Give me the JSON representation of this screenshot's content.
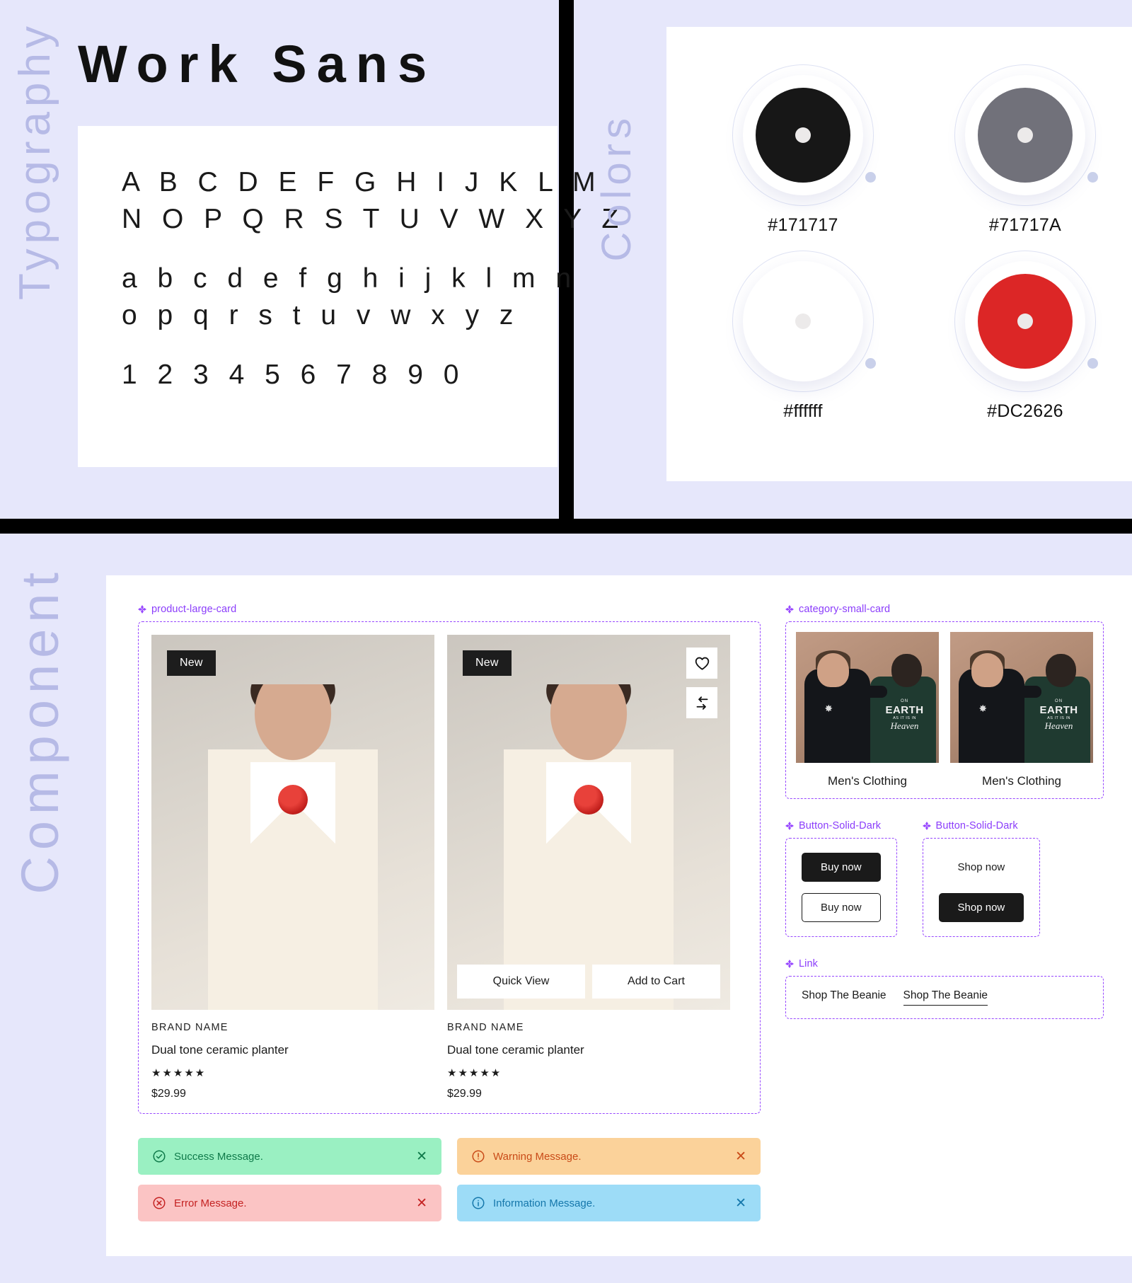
{
  "sections": {
    "typography_label": "Typography",
    "colors_label": "Colors",
    "component_label": "Component"
  },
  "typography": {
    "font_name": "Work Sans",
    "uppercase_line_1": "A B C D E F G H I J K L M",
    "uppercase_line_2": "N O P Q R S T U V W X Y Z",
    "lowercase_line_1": "a b c d e f g h i j k l m n",
    "lowercase_line_2": "o p q r s t u v w x y z",
    "numerals": "1 2 3 4 5 6 7 8 9 0"
  },
  "colors": {
    "swatches": [
      {
        "hex": "#171717",
        "label": "#171717"
      },
      {
        "hex": "#71717A",
        "label": "#71717A"
      },
      {
        "hex": "#ffffff",
        "label": "#ffffff"
      },
      {
        "hex": "#DC2626",
        "label": "#DC2626"
      }
    ],
    "annotation_color": "#9747ff"
  },
  "component": {
    "product_card": {
      "tag": "product-large-card",
      "cards": [
        {
          "badge": "New",
          "brand": "BRAND NAME",
          "name": "Dual tone ceramic planter",
          "rating_stars": "★★★★★",
          "price": "$29.99",
          "has_icons": false,
          "has_overlay_actions": false
        },
        {
          "badge": "New",
          "brand": "BRAND NAME",
          "name": "Dual tone ceramic planter",
          "rating_stars": "★★★★★",
          "price": "$29.99",
          "has_icons": true,
          "wishlist_icon": "heart-icon",
          "compare_icon": "compare-arrows-icon",
          "quick_view_label": "Quick View",
          "add_to_cart_label": "Add to Cart"
        }
      ]
    },
    "category_card": {
      "tag": "category-small-card",
      "items": [
        {
          "label": "Men's Clothing",
          "tee_l1": "ON",
          "tee_l2": "EARTH",
          "tee_l3": "AS IT IS IN",
          "tee_l4": "Heaven"
        },
        {
          "label": "Men's Clothing",
          "tee_l1": "ON",
          "tee_l2": "EARTH",
          "tee_l3": "AS IT IS IN",
          "tee_l4": "Heaven"
        }
      ]
    },
    "buttons": [
      {
        "tag": "Button-Solid-Dark",
        "items": [
          {
            "label": "Buy now",
            "style": "solid"
          },
          {
            "label": "Buy now",
            "style": "ghost"
          }
        ]
      },
      {
        "tag": "Button-Solid-Dark",
        "items": [
          {
            "label": "Shop now",
            "style": "plain"
          },
          {
            "label": "Shop now",
            "style": "solid"
          }
        ]
      }
    ],
    "link": {
      "tag": "Link",
      "items": [
        {
          "label": "Shop The Beanie",
          "underlined": false
        },
        {
          "label": "Shop The Beanie",
          "underlined": true
        }
      ]
    },
    "alerts": [
      {
        "type": "success",
        "icon": "check-circle-icon",
        "message": "Success Message.",
        "bg": "#9af0c2",
        "fg": "#0f7a4a",
        "close": "✕"
      },
      {
        "type": "warning",
        "icon": "alert-circle-icon",
        "message": "Warning Message.",
        "bg": "#fbd29a",
        "fg": "#c94b18",
        "close": "✕"
      },
      {
        "type": "error",
        "icon": "x-circle-icon",
        "message": "Error Message.",
        "bg": "#fbc4c4",
        "fg": "#c42222",
        "close": "✕"
      },
      {
        "type": "information",
        "icon": "info-circle-icon",
        "message": "Information Message.",
        "bg": "#9ddcf7",
        "fg": "#1577ab",
        "close": "✕"
      }
    ]
  }
}
